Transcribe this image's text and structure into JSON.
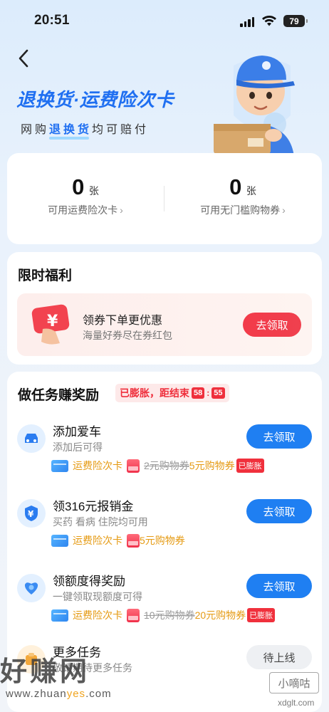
{
  "status_bar": {
    "time": "20:51",
    "battery": "79"
  },
  "hero": {
    "title": "退换货·运费险次卡",
    "subtitle_prefix": "网购",
    "subtitle_highlight": "退换货",
    "subtitle_suffix": "均可赔付"
  },
  "stats": [
    {
      "value": "0",
      "unit": "张",
      "label": "可用运费险次卡"
    },
    {
      "value": "0",
      "unit": "张",
      "label": "可用无门槛购物券"
    }
  ],
  "limited_benefit": {
    "title": "限时福利",
    "coupon_title": "领券下单更优惠",
    "coupon_sub": "海量好券尽在券红包",
    "button": "去领取"
  },
  "tasks_section": {
    "title": "做任务赚奖励",
    "badge_text": "已膨胀，距结束",
    "countdown_min": "58",
    "countdown_sec": "55"
  },
  "tasks": [
    {
      "title": "添加爱车",
      "sub": "添加后可得",
      "button": "去领取",
      "reward_card": "运费险次卡",
      "reward_old": "2元购物券",
      "reward_new": "5元购物券",
      "tag": "已膨胀"
    },
    {
      "title": "领316元报销金",
      "sub": "买药 看病 住院均可用",
      "button": "去领取",
      "reward_card": "运费险次卡",
      "reward_new": "5元购物券"
    },
    {
      "title": "领额度得奖励",
      "sub": "一键领取现额度可得",
      "button": "去领取",
      "reward_card": "运费险次卡",
      "reward_old": "10元购物券",
      "reward_new": "20元购物券",
      "tag": "已膨胀"
    },
    {
      "title": "更多任务",
      "sub": "敬请期待更多任务",
      "button": "待上线"
    }
  ],
  "watermark": {
    "text": "好赚网",
    "url_prefix": "www.zhuan",
    "url_highlight": "yes",
    "url_suffix": ".com",
    "right_text": "小嘀咕",
    "right_url": "xdglt.com"
  },
  "colors": {
    "accent_blue": "#1f7ff2",
    "accent_red": "#f0303c",
    "orange": "#e59a12"
  }
}
